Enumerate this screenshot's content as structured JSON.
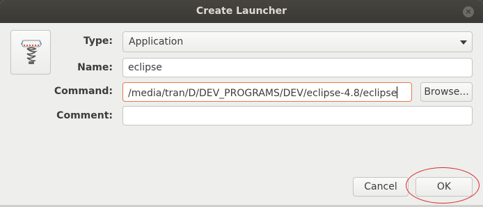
{
  "window": {
    "title": "Create Launcher",
    "close_glyph": "×"
  },
  "icon": {
    "name": "launcher-spring-icon"
  },
  "form": {
    "type_label": "Type:",
    "type_value": "Application",
    "name_label": "Name:",
    "name_value": "eclipse",
    "command_label": "Command:",
    "command_value": "/media/tran/D/DEV_PROGRAMS/DEV/eclipse-4.8/eclipse",
    "browse_label": "Browse...",
    "comment_label": "Comment:",
    "comment_value": ""
  },
  "buttons": {
    "cancel_label": "Cancel",
    "ok_label": "OK"
  },
  "colors": {
    "focus_border": "#e77a48",
    "annotation_ring": "#d62b2b",
    "titlebar": "#3c3b37"
  }
}
